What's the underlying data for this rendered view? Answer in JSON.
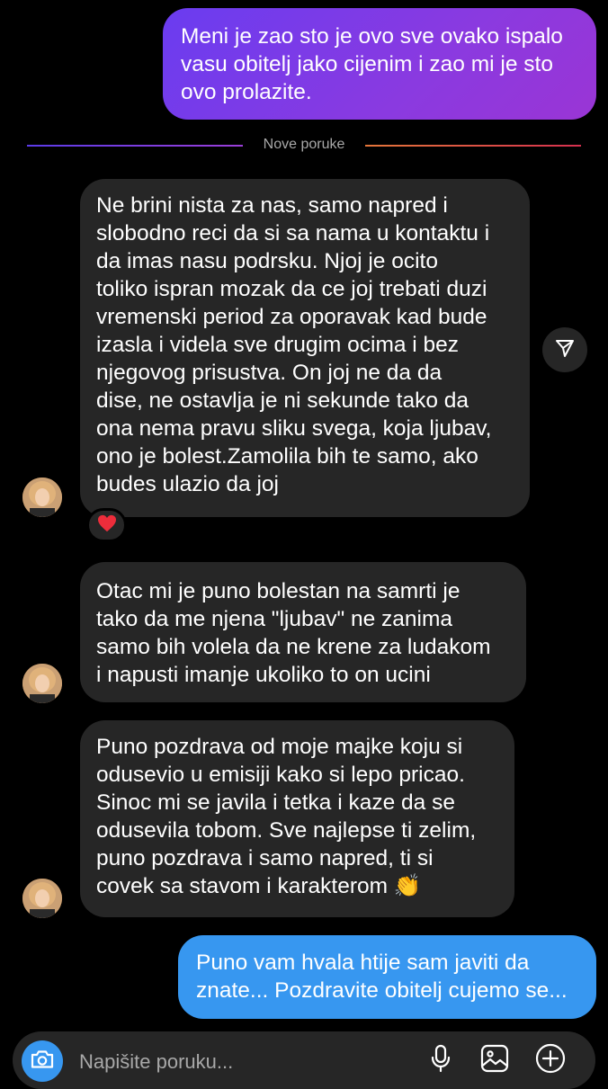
{
  "conversation": {
    "divider_label": "Nove poruke",
    "messages": [
      {
        "id": "out-1",
        "direction": "outgoing",
        "text": "Meni je zao sto je ovo sve ovako ispalo\nvasu obitelj jako cijenim i zao mi je sto\novo prolazite."
      },
      {
        "id": "in-1",
        "direction": "incoming",
        "text": "Ne brini nista za nas, samo napred i\nslobodno reci da si sa nama u kontaktu i\nda imas nasu podrsku. Njoj je ocito\ntoliko ispran mozak da ce joj trebati duzi\nvremenski period za oporavak kad bude\nizasla i videla sve drugim ocima i bez\nnjegovog prisustva. On joj ne da da\ndise, ne ostavlja je ni sekunde tako da\nona nema pravu sliku svega, koja ljubav,\nono je bolest.Zamolila bih te samo, ako\nbudes ulazio da joj",
        "reaction": "❤️"
      },
      {
        "id": "in-2",
        "direction": "incoming",
        "text": "Otac mi je puno bolestan na samrti je\ntako da me njena \"ljubav\" ne zanima\nsamo bih volela da ne krene za ludakom\ni napusti imanje ukoliko to on ucini"
      },
      {
        "id": "in-3",
        "direction": "incoming",
        "text": "Puno pozdrava od moje majke koju si\nodusevio u emisiji kako si lepo pricao.\nSinoc mi se javila i tetka i kaze da se\nodusevila tobom. Sve najlepse ti zelim,\npuno pozdrava i samo napred, ti si\ncovek sa stavom i karakterom 👏"
      },
      {
        "id": "out-2",
        "direction": "outgoing",
        "text": "Puno vam hvala htije sam javiti da\nznate... Pozdravite obitelj cujemo se..."
      }
    ]
  },
  "composer": {
    "placeholder": "Napišite poruku...",
    "icons": {
      "camera": "camera-icon",
      "mic": "microphone-icon",
      "gallery": "image-icon",
      "plus": "plus-icon"
    }
  },
  "icons": {
    "share": "send-icon",
    "avatar": "contact-avatar"
  },
  "colors": {
    "background": "#000000",
    "outgoing_gradient_start": "#6a3cf0",
    "outgoing_gradient_end": "#9a35d5",
    "outgoing_blue": "#3797f0",
    "incoming_bubble": "#262626",
    "secondary_text": "#a8a8a8"
  }
}
